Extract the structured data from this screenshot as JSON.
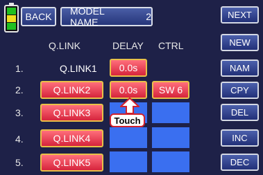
{
  "header": {
    "back_label": "BACK",
    "model_label": "MODEL NAME",
    "model_number": "2"
  },
  "side_buttons": [
    "NEXT",
    "NEW",
    "NAM",
    "CPY",
    "DEL",
    "INC",
    "DEC"
  ],
  "columns": {
    "qlink": "Q.LINK",
    "delay": "DELAY",
    "ctrl": "CTRL"
  },
  "rows": [
    {
      "num": "1.",
      "name": "Q.LINK1",
      "delay": "0.0s",
      "ctrl": ""
    },
    {
      "num": "2.",
      "name": "Q.LINK2",
      "delay": "0.0s",
      "ctrl": "SW 6"
    },
    {
      "num": "3.",
      "name": "Q.LINK3",
      "delay": "",
      "ctrl": ""
    },
    {
      "num": "4.",
      "name": "Q.LINK4",
      "delay": "",
      "ctrl": ""
    },
    {
      "num": "5.",
      "name": "Q.LINK5",
      "delay": "",
      "ctrl": ""
    }
  ],
  "callout": {
    "label": "Touch"
  },
  "colors": {
    "background": "#1e2148",
    "active_button": "#e8344a",
    "cell_blue": "#3a6ff0",
    "callout_border": "#d0202c"
  }
}
